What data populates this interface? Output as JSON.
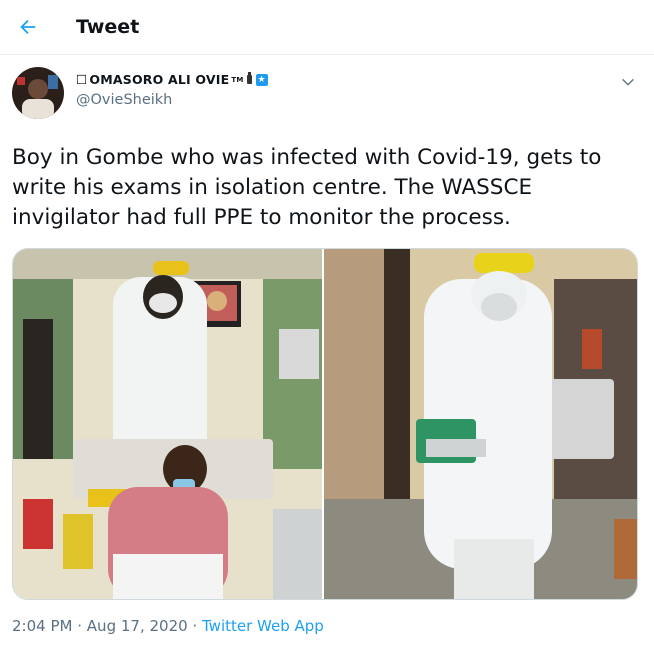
{
  "header": {
    "title": "Tweet"
  },
  "author": {
    "display_name": "OMASORO ALI OVIE",
    "name_prefix": "☐",
    "tm": "TM",
    "badge": "★",
    "handle": "@OvieSheikh"
  },
  "tweet": {
    "text": "Boy in Gombe who was infected with Covid-19, gets to write his exams in isolation centre. The WASSCE invigilator had full PPE to monitor the process."
  },
  "meta": {
    "time": "2:04 PM",
    "sep1": "·",
    "date": "Aug 17, 2020",
    "sep2": "·",
    "source": "Twitter Web App"
  },
  "colors": {
    "accent": "#1da1f2",
    "secondary_text": "#5b7083",
    "border": "#e6ecf0"
  }
}
